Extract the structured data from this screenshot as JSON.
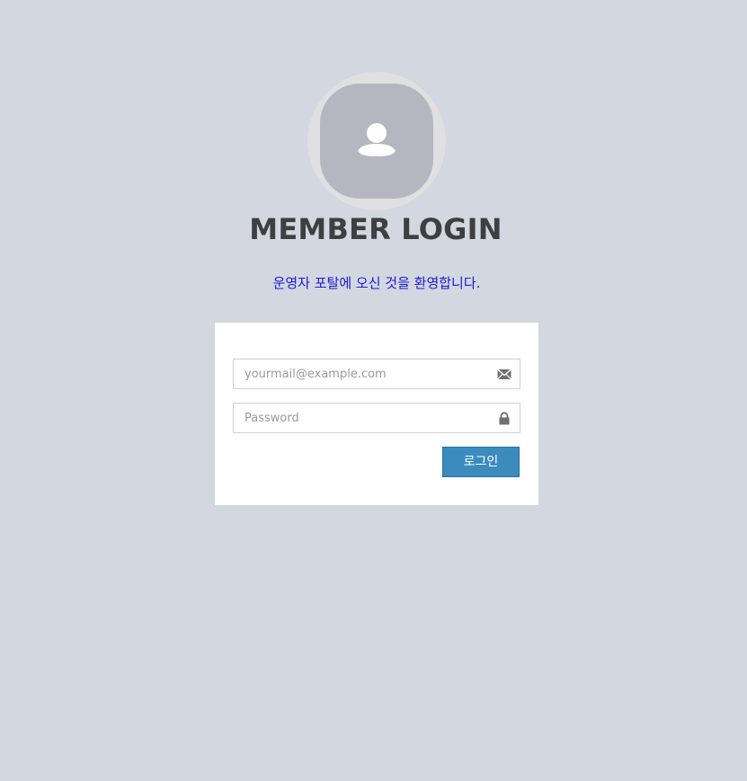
{
  "header": {
    "title": "MEMBER LOGIN",
    "welcome_message": "운영자 포탈에 오신 것을 환영합니다."
  },
  "avatar": {
    "icon": "user-icon"
  },
  "login_form": {
    "email": {
      "placeholder": "yourmail@example.com",
      "value": "",
      "icon": "envelope-icon"
    },
    "password": {
      "placeholder": "Password",
      "value": "",
      "icon": "lock-icon"
    },
    "submit_label": "로그인"
  },
  "colors": {
    "background": "#d3d7df",
    "title": "#3e3f42",
    "welcome": "#1a1ad6",
    "button": "#3b8bbf",
    "panel": "#ffffff"
  }
}
